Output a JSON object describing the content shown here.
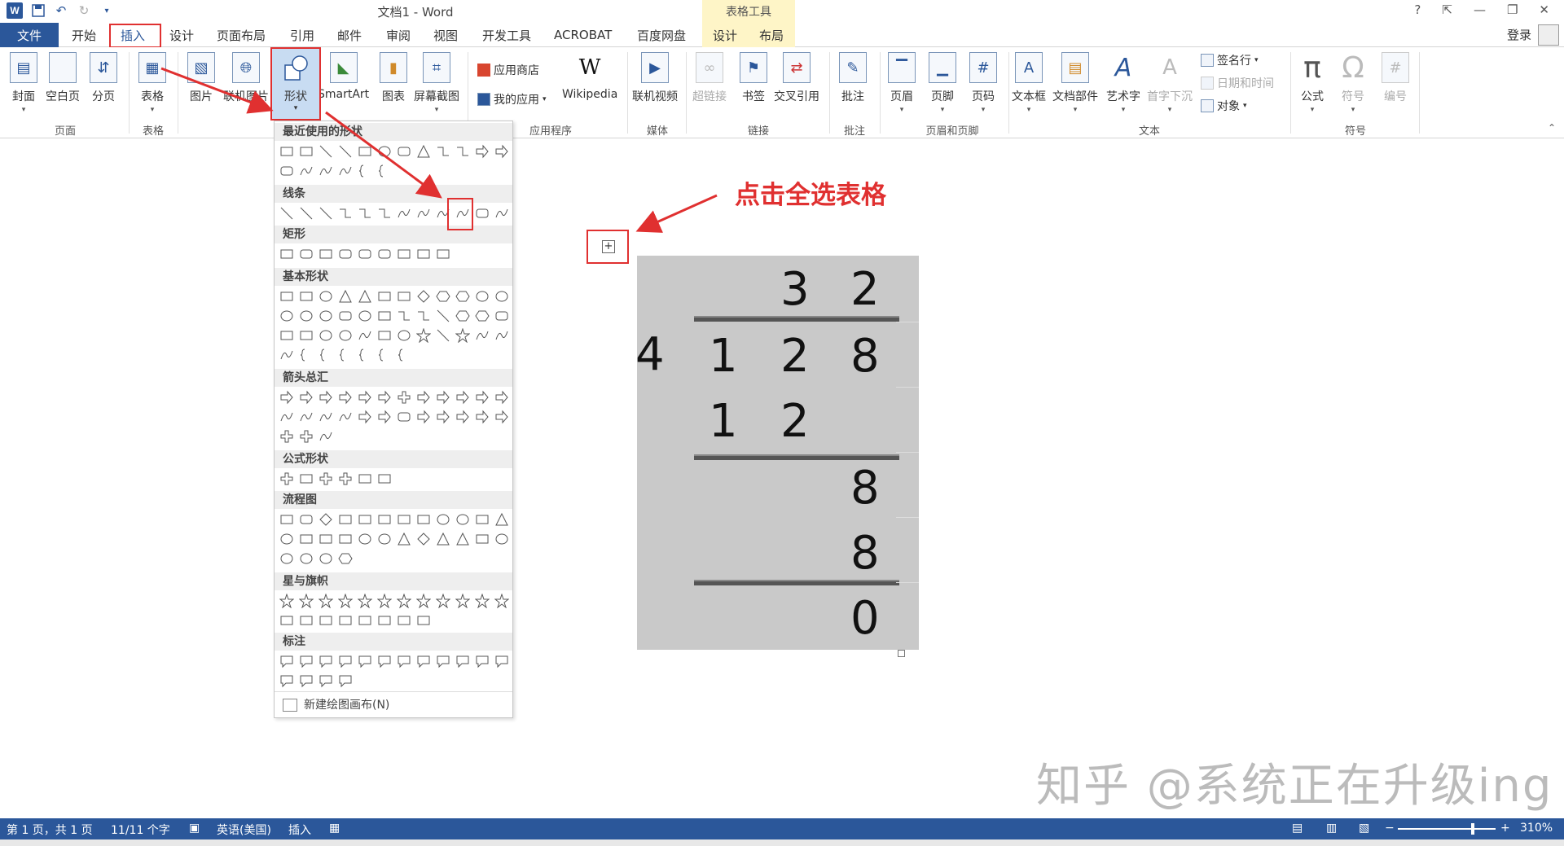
{
  "titlebar": {
    "app_icon": "W",
    "title": "文档1 - Word",
    "context_header": "表格工具",
    "help": "?",
    "minimize": "—",
    "restore": "❐",
    "close": "✕",
    "ribbon_options": "⇱"
  },
  "tabs": {
    "file": "文件",
    "home": "开始",
    "insert": "插入",
    "design": "设计",
    "layout_page": "页面布局",
    "references": "引用",
    "mailings": "邮件",
    "review": "审阅",
    "view": "视图",
    "developer": "开发工具",
    "acrobat": "ACROBAT",
    "baidu": "百度网盘",
    "table_design": "设计",
    "table_layout": "布局",
    "login": "登录"
  },
  "ribbon": {
    "cover": "封面",
    "blank_page": "空白页",
    "page_break": "分页",
    "table": "表格",
    "picture": "图片",
    "online_picture": "联机图片",
    "shapes": "形状",
    "smartart": "SmartArt",
    "chart": "图表",
    "screenshot": "屏幕截图",
    "store": "应用商店",
    "my_apps": "我的应用",
    "wikipedia": "Wikipedia",
    "online_video": "联机视频",
    "hyperlink": "超链接",
    "bookmark": "书签",
    "cross_ref": "交叉引用",
    "comment": "批注",
    "header": "页眉",
    "footer": "页脚",
    "page_number": "页码",
    "textbox": "文本框",
    "quick_parts": "文档部件",
    "wordart": "艺术字",
    "dropcap": "首字下沉",
    "signature": "签名行",
    "datetime": "日期和时间",
    "object": "对象",
    "equation": "公式",
    "symbol": "符号",
    "number": "编号",
    "groups": {
      "pages": "页面",
      "tables": "表格",
      "apps": "应用程序",
      "media": "媒体",
      "links": "链接",
      "comments": "批注",
      "header_footer": "页眉和页脚",
      "text": "文本",
      "symbols": "符号"
    }
  },
  "shapes_menu": {
    "recent": "最近使用的形状",
    "lines": "线条",
    "rectangles": "矩形",
    "basic": "基本形状",
    "arrows": "箭头总汇",
    "equation": "公式形状",
    "flowchart": "流程图",
    "stars": "星与旗帜",
    "callouts": "标注",
    "new_canvas": "新建绘图画布(N)"
  },
  "annotation": "点击全选表格",
  "division": {
    "quotient": [
      "3",
      "2"
    ],
    "divisor": "4",
    "dividend": [
      "1",
      "2",
      "8"
    ],
    "step1": [
      "1",
      "2"
    ],
    "remainder1": "8",
    "step2": "8",
    "result": "0"
  },
  "watermark": "知乎 @系统正在升级ing",
  "status": {
    "page": "第 1 页，共 1 页",
    "words": "11/11 个字",
    "language": "英语(美国)",
    "mode": "插入",
    "zoom": "310%",
    "zoom_minus": "−",
    "zoom_plus": "+"
  },
  "colors": {
    "brand": "#2b579a",
    "highlight_red": "#e03030",
    "table_bg": "#c9c9c9",
    "context_tab": "#fef5c7"
  }
}
